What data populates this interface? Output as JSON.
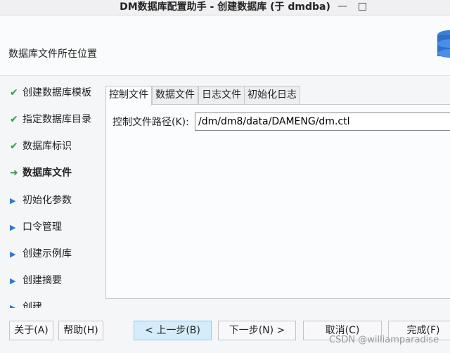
{
  "window": {
    "title": "DM数据库配置助手 - 创建数据库 (于 dmdba)",
    "minimize": "—"
  },
  "header": {
    "title": "数据库文件所在位置"
  },
  "steps": [
    {
      "label": "创建数据库模板",
      "icon": "✔",
      "state": "done"
    },
    {
      "label": "指定数据库目录",
      "icon": "✔",
      "state": "done"
    },
    {
      "label": "数据库标识",
      "icon": "✔",
      "state": "done"
    },
    {
      "label": "数据库文件",
      "icon": "➜",
      "state": "current"
    },
    {
      "label": "初始化参数",
      "icon": "▶",
      "state": "todo"
    },
    {
      "label": "口令管理",
      "icon": "▶",
      "state": "todo"
    },
    {
      "label": "创建示例库",
      "icon": "▶",
      "state": "todo"
    },
    {
      "label": "创建摘要",
      "icon": "▶",
      "state": "todo"
    },
    {
      "label": "创建",
      "icon": "▶",
      "state": "todo"
    }
  ],
  "tabs": [
    "控制文件",
    "数据文件",
    "日志文件",
    "初始化日志"
  ],
  "control_file": {
    "label": "控制文件路径(K):",
    "value": "/dm/dm8/data/DAMENG/dm.ctl"
  },
  "buttons": {
    "about": "关于(A)",
    "help": "帮助(H)",
    "prev": "< 上一步(B)",
    "next": "下一步(N) >",
    "cancel": "取消(C)",
    "finish": "完成(F)"
  },
  "watermark": "CSDN @williamparadise"
}
